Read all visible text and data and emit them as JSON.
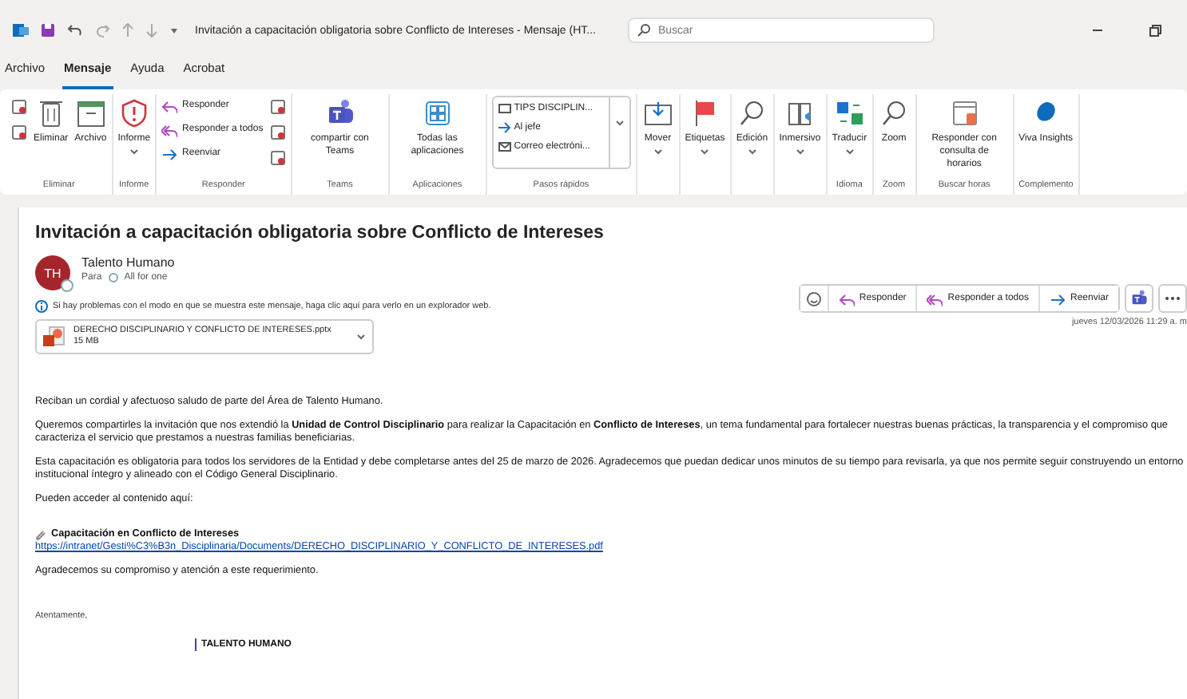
{
  "window": {
    "title": "Invitación a capacitación obligatoria sobre Conflicto de Intereses  -  Mensaje (HT...",
    "search": {
      "placeholder": "Buscar"
    }
  },
  "menu_tabs": [
    {
      "label": "Archivo",
      "selected": false
    },
    {
      "label": "Mensaje",
      "selected": true
    },
    {
      "label": "Ayuda",
      "selected": false
    },
    {
      "label": "Acrobat",
      "selected": false
    }
  ],
  "ribbon": {
    "groups": [
      {
        "label": "Eliminar",
        "items": [
          {
            "kind": "icons"
          },
          {
            "kind": "large",
            "label": "Eliminar"
          },
          {
            "kind": "large",
            "label": "Archivo"
          }
        ]
      },
      {
        "label": "Informe",
        "items": [
          {
            "kind": "large",
            "label": "Informe",
            "dropdown": true
          }
        ]
      },
      {
        "label": "Responder",
        "items": [
          {
            "kind": "small",
            "label": "Responder"
          },
          {
            "kind": "small",
            "label": "Responder a todos"
          },
          {
            "kind": "small",
            "label": "Reenviar"
          },
          {
            "kind": "icons"
          }
        ]
      },
      {
        "label": "Teams",
        "items": [
          {
            "kind": "large",
            "label": "compartir con Teams"
          }
        ]
      },
      {
        "label": "Aplicaciones",
        "items": [
          {
            "kind": "large",
            "label": "Todas las aplicaciones"
          }
        ]
      },
      {
        "label": "Pasos rápidos",
        "items": [
          {
            "kind": "gallery",
            "entries": [
              "TIPS DISCIPLIN...",
              "Al jefe",
              "Correo electróni..."
            ]
          }
        ]
      },
      {
        "items": [
          {
            "kind": "large",
            "label": "Mover",
            "dropdown": true
          }
        ]
      },
      {
        "items": [
          {
            "kind": "large",
            "label": "Etiquetas",
            "dropdown": true
          }
        ]
      },
      {
        "items": [
          {
            "kind": "large",
            "label": "Edición",
            "dropdown": true
          }
        ]
      },
      {
        "items": [
          {
            "kind": "large",
            "label": "Inmersivo",
            "dropdown": true
          }
        ]
      },
      {
        "label": "Idioma",
        "items": [
          {
            "kind": "large",
            "label": "Traducir",
            "dropdown": true
          }
        ]
      },
      {
        "label": "Zoom",
        "items": [
          {
            "kind": "large",
            "label": "Zoom"
          }
        ]
      },
      {
        "label": "Buscar horas",
        "items": [
          {
            "kind": "large",
            "label": "Responder con consulta de horarios"
          }
        ]
      },
      {
        "label": "Complemento",
        "items": [
          {
            "kind": "large",
            "label": "Viva Insights"
          }
        ]
      }
    ]
  },
  "message": {
    "subject": "Invitación a capacitación obligatoria sobre Conflicto de Intereses",
    "sender": {
      "name": "Talento Humano",
      "initials": "TH"
    },
    "to_label": "Para",
    "recipient": "All for one",
    "info": "Si hay problemas con el modo en que se muestra este mensaje, haga clic aquí para verlo en un explorador web.",
    "attachment": {
      "name": "DERECHO DISCIPLINARIO Y CONFLICTO DE INTERESES.pptx",
      "size": "15 MB"
    },
    "actions": [
      "Responder",
      "Responder a todos",
      "Reenviar"
    ],
    "date": "jueves 12/03/2026 11:29 a. m",
    "body": [
      {
        "kind": "text",
        "text": "Reciban un cordial y afectuoso saludo de parte del Área de Talento Humano."
      },
      {
        "kind": "text",
        "text": "Queremos compartirles la invitación que nos extendió la **Unidad de Control Disciplinario** para realizar la Capacitación en **Conflicto de Intereses**, un tema fundamental para fortalecer nuestras buenas prácticas, la transparencia y el compromiso que caracteriza el servicio que prestamos a nuestras familias beneficiarias."
      },
      {
        "kind": "text",
        "text": "Esta capacitación es obligatoria para todos los servidores de la Entidad y debe completarse antes del 25 de marzo de 2026. Agradecemos que puedan dedicar unos minutos de su tiempo para revisarla, ya que nos permite seguir construyendo un entorno institucional íntegro y alineado con el Código General Disciplinario."
      },
      {
        "kind": "text",
        "text": "Pueden acceder al contenido aquí:"
      },
      {
        "kind": "link_title",
        "text": "Capacitación en Conflicto de Intereses"
      },
      {
        "kind": "link",
        "text": "https://intranet/Gesti%C3%B3n_Disciplinaria/Documents/DERECHO_DISCIPLINARIO_Y_CONFLICTO_DE_INTERESES.pdf"
      },
      {
        "kind": "text",
        "text": "Agradecemos su compromiso y atención a este requerimiento."
      },
      {
        "kind": "signoff",
        "text": "Atentamente,"
      },
      {
        "kind": "signature",
        "text": "TALENTO HUMANO"
      }
    ]
  }
}
